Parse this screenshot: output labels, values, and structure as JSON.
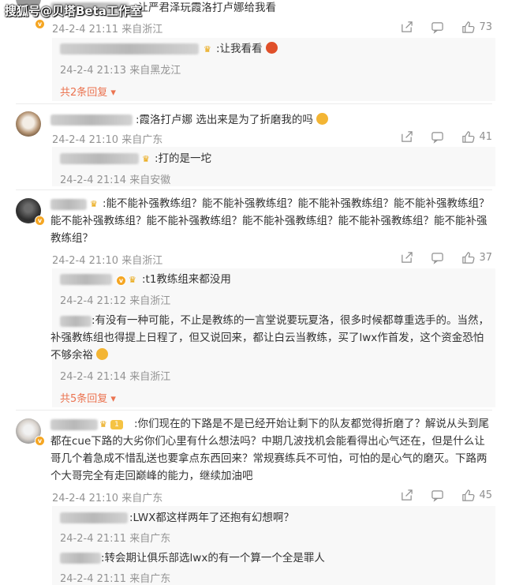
{
  "watermark": "搜狐号@贝塔Beta工作室",
  "comments": [
    {
      "text": ":让严君泽玩霞洛打卢娜给我看",
      "time": "24-2-4 21:11",
      "location": "来自浙江",
      "likes": "73",
      "replies": [
        {
          "text": ":让我看看",
          "time": "24-2-4 21:13",
          "location": "来自黑龙江"
        }
      ],
      "expand": "共2条回复"
    },
    {
      "text": ":霞洛打卢娜 选出来是为了折磨我的吗",
      "time": "24-2-4 21:10",
      "location": "来自广东",
      "likes": "41",
      "replies": [
        {
          "text": ":打的是一坨",
          "time": "24-2-4 21:14",
          "location": "来自安徽"
        }
      ]
    },
    {
      "text": ":能不能补强教练组？能不能补强教练组？能不能补强教练组？能不能补强教练组？能不能补强教练组？能不能补强教练组？能不能补强教练组？能不能补强教练组？能不能补强教练组？",
      "time": "24-2-4 21:10",
      "location": "来自浙江",
      "likes": "37",
      "replies": [
        {
          "text": ":t1教练组来都没用",
          "time": "24-2-4 21:12",
          "location": "来自浙江"
        },
        {
          "text": ":有没有一种可能，不止是教练的一言堂说要玩夏洛，很多时候都尊重选手的。当然，补强教练组也得提上日程了，但又说回来，都让白云当教练，买了lwx作首发，这个资金恐怕不够余裕",
          "time": "24-2-4 21:14",
          "location": "来自浙江"
        }
      ],
      "expand": "共5条回复"
    },
    {
      "text": ":你们现在的下路是不是已经开始让剩下的队友都觉得折磨了？解说从头到尾都在cue下路的大劣你们心里有什么想法吗？中期几波找机会能看得出心气还在，但是什么让哥几个着急成不惜乱送也要拿点东西回来？常规赛练兵不可怕，可怕的是心气的磨灭。下路两个大哥完全有走回巅峰的能力，继续加油吧",
      "time": "24-2-4 21:10",
      "location": "来自广东",
      "likes": "45",
      "replies": [
        {
          "text": ":LWX都这样两年了还抱有幻想啊？",
          "time": "24-2-4 21:11",
          "location": "来自广东"
        },
        {
          "text": ":转会期让俱乐部选lwx的有一个算一个全是罪人",
          "time": "24-2-4 21:11",
          "location": "来自广东"
        }
      ]
    }
  ],
  "colors": {
    "accent": "#eb7350",
    "meta": "#939393",
    "badge": "#f5a623"
  }
}
